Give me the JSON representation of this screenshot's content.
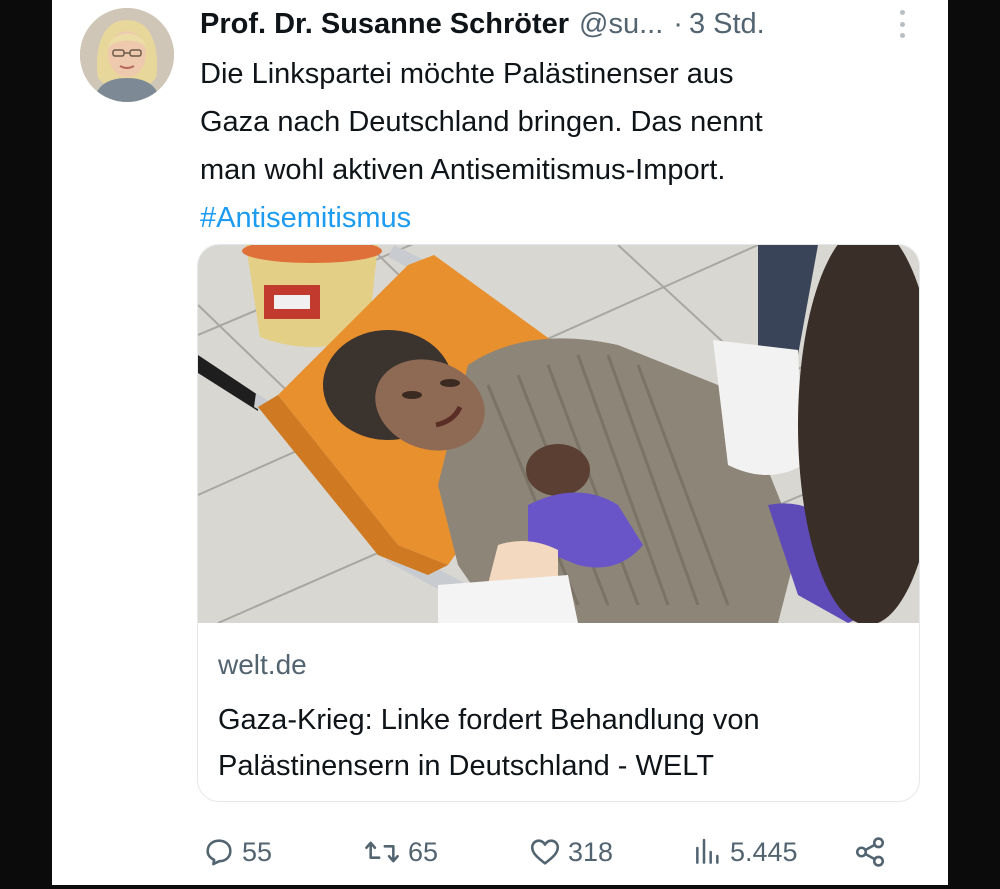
{
  "tweet": {
    "author_name": "Prof. Dr. Susanne Schröter",
    "handle": "@su...",
    "separator": "·",
    "time": "3 Std.",
    "text_lines": [
      "Die Linkspartei möchte Palästinenser aus",
      "Gaza nach Deutschland bringen. Das nennt",
      "man wohl aktiven Antisemitismus-Import."
    ],
    "hashtag": "#Antisemitismus",
    "more_icon": "more-vertical-icon"
  },
  "link_card": {
    "domain": "welt.de",
    "title": "Gaza-Krieg: Linke fordert Behandlung von Palästinensern in Deutschland - WELT"
  },
  "actions": {
    "replies": "55",
    "reposts": "65",
    "likes": "318",
    "views": "5.445",
    "icons": [
      "reply-icon",
      "repost-icon",
      "like-icon",
      "views-icon",
      "share-icon"
    ]
  },
  "colors": {
    "text": "#0f1419",
    "secondary": "#536471",
    "hashtag": "#1d9bf0",
    "stretcher": "#e8902e"
  }
}
